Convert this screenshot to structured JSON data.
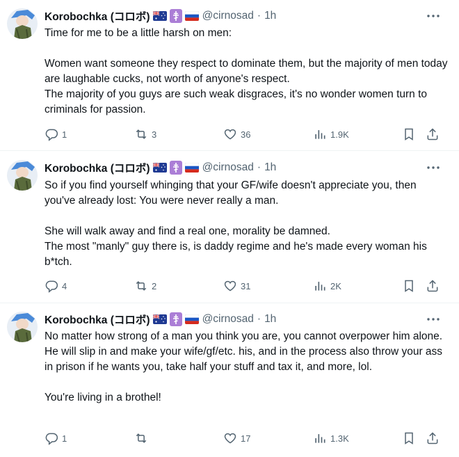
{
  "tweets": [
    {
      "author": {
        "name": "Korobochka (コロボ)",
        "handle": "@cirnosad",
        "separator": "·",
        "time": "1h"
      },
      "text": "Time for me to be a little harsh on men:\n\nWomen want someone they respect to dominate them, but the majority of men today are laughable cucks, not worth of anyone's respect.\nThe majority of you guys are such weak disgraces, it's no wonder women turn to criminals for passion.",
      "stats": {
        "replies": "1",
        "reposts": "3",
        "likes": "36",
        "views": "1.9K"
      }
    },
    {
      "author": {
        "name": "Korobochka (コロボ)",
        "handle": "@cirnosad",
        "separator": "·",
        "time": "1h"
      },
      "text": "So if you find yourself whinging that your GF/wife doesn't appreciate you, then you've already lost: You were never really a man.\n\nShe will walk away and find a real one, morality be damned.\nThe most \"manly\" guy there is, is daddy regime and he's made every woman his b*tch.",
      "stats": {
        "replies": "4",
        "reposts": "2",
        "likes": "31",
        "views": "2K"
      }
    },
    {
      "author": {
        "name": "Korobochka (コロボ)",
        "handle": "@cirnosad",
        "separator": "·",
        "time": "1h"
      },
      "text": "No matter how strong of a man you think you are, you cannot overpower him alone. He will slip in and make your wife/gf/etc. his, and in the process also throw your ass in prison if he wants you, take half your stuff and tax it, and more, lol.\n\nYou're living in a brothel!",
      "stats": {
        "replies": "1",
        "reposts": "",
        "likes": "17",
        "views": "1.3K"
      }
    }
  ],
  "badges": [
    "australia-flag",
    "orthodox-cross",
    "russia-flag"
  ],
  "colors": {
    "text": "#0f1419",
    "secondary": "#536471",
    "divider": "#eff3f4",
    "cross_badge": "#ab7ed6"
  },
  "icons": [
    "reply-icon",
    "repost-icon",
    "like-icon",
    "views-icon",
    "bookmark-icon",
    "share-icon",
    "more-icon"
  ]
}
